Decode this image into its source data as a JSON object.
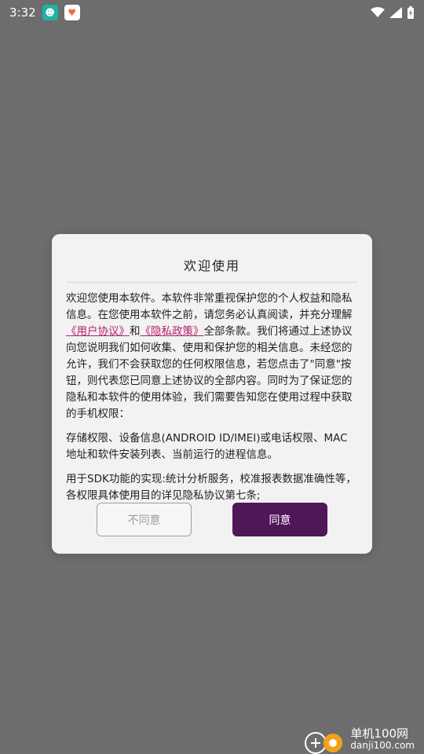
{
  "status_bar": {
    "time": "3:32",
    "app_icons": [
      "pet-app-icon",
      "heart-app-icon"
    ]
  },
  "dialog": {
    "title": "欢迎使用",
    "paragraph1_parts": {
      "part1": "欢迎您使用本软件。本软件非常重视保护您的个人权益和隐私信息。在您使用本软件之前，请您务必认真阅读，",
      "part2": "并充分理解",
      "link1": "《用户协议》",
      "part3": "和",
      "link2": "《隐私政策》",
      "part4": "全部条款。我们将通过上述协议向您说明我们如何收集、使用和保护您的相关信息。未经您的允许，我们不会获取您的任何权限信息，若您点击了\"同意\"按钮，则代表您已同意上述协议的全部内容。同时为了保证您的隐私和本软件的使用体验，我们需要告知您在使用过程中获取的手机权限："
    },
    "paragraph2": "存储权限、设备信息(ANDROID ID/IMEI)或电话权限、MAC地址和软件安装列表、当前运行的进程信息。",
    "paragraph3": "用于SDK功能的实现:统计分析服务，校准报表数据准确性等，各权限具体使用目的详见隐私协议第七条;",
    "decline_label": "不同意",
    "accept_label": "同意"
  },
  "watermark": {
    "line1": "单机100网",
    "line2": "danji100.com"
  }
}
